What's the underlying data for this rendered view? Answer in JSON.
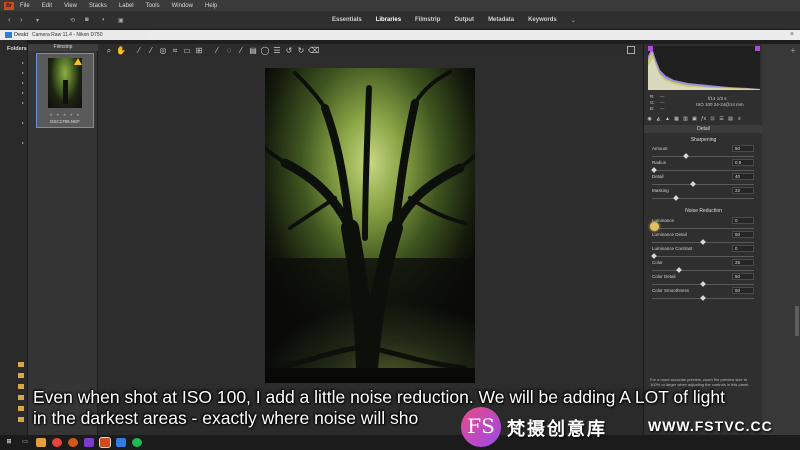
{
  "menubar": {
    "logo": "Br",
    "items": [
      "File",
      "Edit",
      "View",
      "Stacks",
      "Label",
      "Tools",
      "Window",
      "Help"
    ]
  },
  "toolbar": {
    "workspaces": [
      "Essentials",
      "Libraries",
      "Filmstrip",
      "Output",
      "Metadata",
      "Keywords"
    ],
    "active_workspace": "Libraries",
    "more": "⌄"
  },
  "pathbar": {
    "text": "Desktop"
  },
  "dialog": {
    "title": "Camera Raw 11.4  -  Nikon D750"
  },
  "folders": {
    "header": "Folders"
  },
  "filmstrip": {
    "header": "Filmstrip",
    "thumb_filename": "DSC1785.NEF",
    "thumb_stars": "★ ★ ★ ★ ★"
  },
  "readout": {
    "r_label": "R:",
    "g_label": "G:",
    "b_label": "B:",
    "r_val": "---",
    "g_val": "---",
    "b_val": "---",
    "exposure": "f/14   1/3 s",
    "iso": "ISO 100   24-24@14 mm"
  },
  "panel": {
    "title": "Detail",
    "sharpening_header": "Sharpening",
    "noise_header": "Noise Reduction",
    "sharpening": [
      {
        "label": "Amount",
        "value": "50",
        "pos": 0.33
      },
      {
        "label": "Radius",
        "value": "0.5",
        "pos": 0.0
      },
      {
        "label": "Detail",
        "value": "40",
        "pos": 0.4
      },
      {
        "label": "Masking",
        "value": "22",
        "pos": 0.22
      }
    ],
    "noise": [
      {
        "label": "Luminance",
        "value": "0",
        "pos": 0.0
      },
      {
        "label": "Luminance Detail",
        "value": "50",
        "pos": 0.5
      },
      {
        "label": "Luminance Contrast",
        "value": "0",
        "pos": 0.0
      },
      {
        "label": "Color",
        "value": "25",
        "pos": 0.25
      },
      {
        "label": "Color Detail",
        "value": "50",
        "pos": 0.5
      },
      {
        "label": "Color Smoothness",
        "value": "50",
        "pos": 0.5
      }
    ],
    "help": "For a more accurate preview, zoom the preview size to 100% or larger when adjusting the controls in this panel."
  },
  "caption": {
    "line1": "Even when shot at ISO 100, I add a little noise reduction. We will be adding A LOT of light",
    "line2": "in the darkest areas - exactly where noise will sho"
  },
  "watermark": {
    "logo": "FS",
    "cn": "梵摄创意库",
    "site": "WWW.FSTVC.CC"
  }
}
